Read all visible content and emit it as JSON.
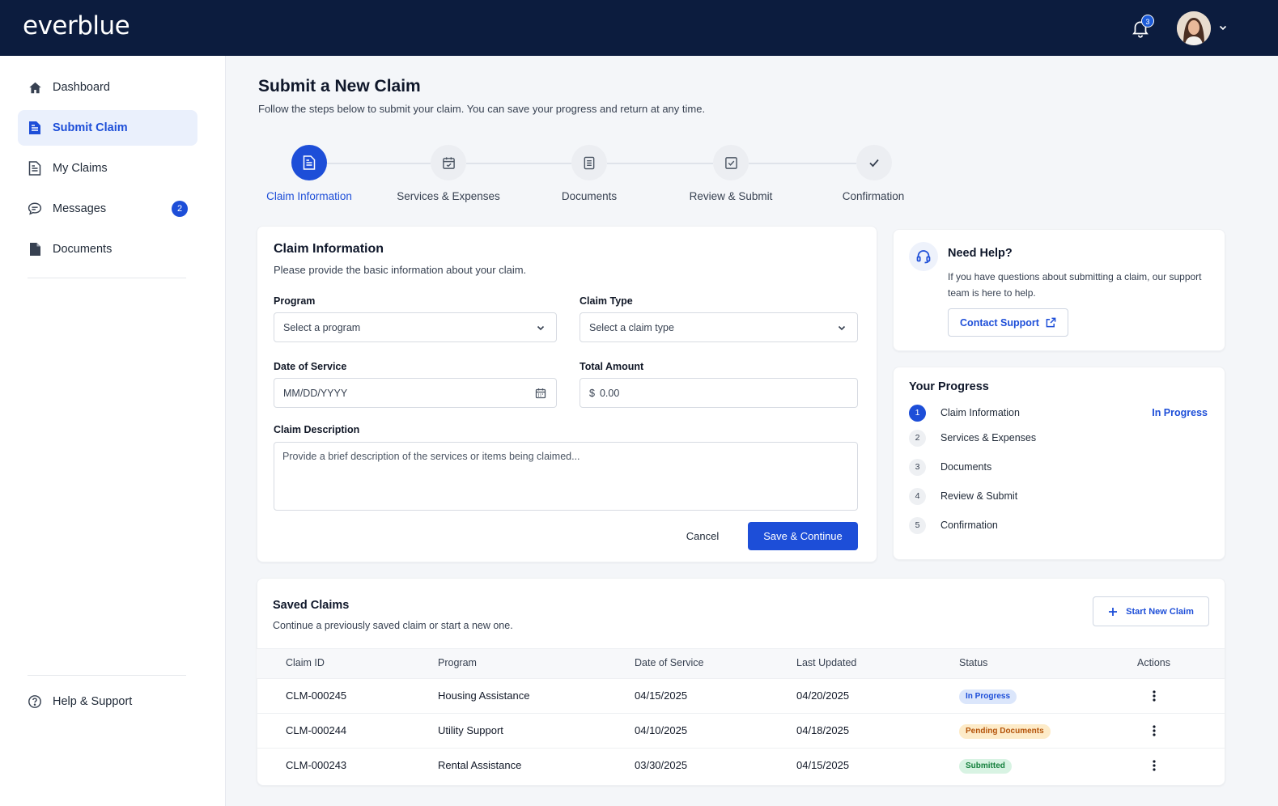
{
  "brand": {
    "logo": "everblue"
  },
  "header": {
    "notification_count": "3"
  },
  "sidebar": {
    "items": [
      {
        "label": "Dashboard",
        "icon": "home-icon"
      },
      {
        "label": "Submit Claim",
        "icon": "file-text-icon",
        "active": true
      },
      {
        "label": "My Claims",
        "icon": "file-list-icon"
      },
      {
        "label": "Messages",
        "icon": "chat-icon",
        "badge": "2"
      },
      {
        "label": "Documents",
        "icon": "document-icon"
      }
    ],
    "help": "Help & Support"
  },
  "page": {
    "title": "Submit a New Claim",
    "subtitle": "Follow the steps below to submit your claim. You can save your progress and return at any time."
  },
  "stepper": {
    "steps": [
      "Claim Information",
      "Services & Expenses",
      "Documents",
      "Review & Submit",
      "Confirmation"
    ]
  },
  "form": {
    "title": "Claim Information",
    "subtitle": "Please provide the basic information about your claim.",
    "program_label": "Program",
    "program_placeholder": "Select a program",
    "claim_type_label": "Claim Type",
    "claim_type_placeholder": "Select a claim type",
    "date_label": "Date of Service",
    "date_placeholder": "MM/DD/YYYY",
    "amount_label": "Total Amount",
    "amount_prefix": "$",
    "amount_placeholder": "0.00",
    "description_label": "Claim Description",
    "description_placeholder": "Provide a brief description of the services or items being claimed...",
    "cancel": "Cancel",
    "save": "Save & Continue"
  },
  "help_card": {
    "title": "Need Help?",
    "text": "If you have questions about submitting a claim, our support team is here to help.",
    "button": "Contact Support"
  },
  "progress": {
    "title": "Your Progress",
    "items": [
      {
        "num": "1",
        "label": "Claim Information",
        "status": "In Progress"
      },
      {
        "num": "2",
        "label": "Services & Expenses"
      },
      {
        "num": "3",
        "label": "Documents"
      },
      {
        "num": "4",
        "label": "Review & Submit"
      },
      {
        "num": "5",
        "label": "Confirmation"
      }
    ]
  },
  "saved": {
    "title": "Saved Claims",
    "subtitle": "Continue a previously saved claim or start a new one.",
    "new_button": "Start New Claim",
    "columns": [
      "Claim ID",
      "Program",
      "Date of Service",
      "Last Updated",
      "Status",
      "Actions"
    ],
    "rows": [
      {
        "id": "CLM-000245",
        "program": "Housing Assistance",
        "date": "04/15/2025",
        "updated": "04/20/2025",
        "status": "In Progress"
      },
      {
        "id": "CLM-000244",
        "program": "Utility Support",
        "date": "04/10/2025",
        "updated": "04/18/2025",
        "status": "Pending Documents"
      },
      {
        "id": "CLM-000243",
        "program": "Rental Assistance",
        "date": "03/30/2025",
        "updated": "04/15/2025",
        "status": "Submitted"
      }
    ]
  },
  "colors": {
    "navy": "#0c1c3e",
    "primary": "#1d4ed8",
    "in_progress_bg": "#dbe6fb",
    "pending_bg": "#fdebc8",
    "pending_fg": "#b45309",
    "submitted_bg": "#d8f3e3",
    "submitted_fg": "#15803d"
  }
}
